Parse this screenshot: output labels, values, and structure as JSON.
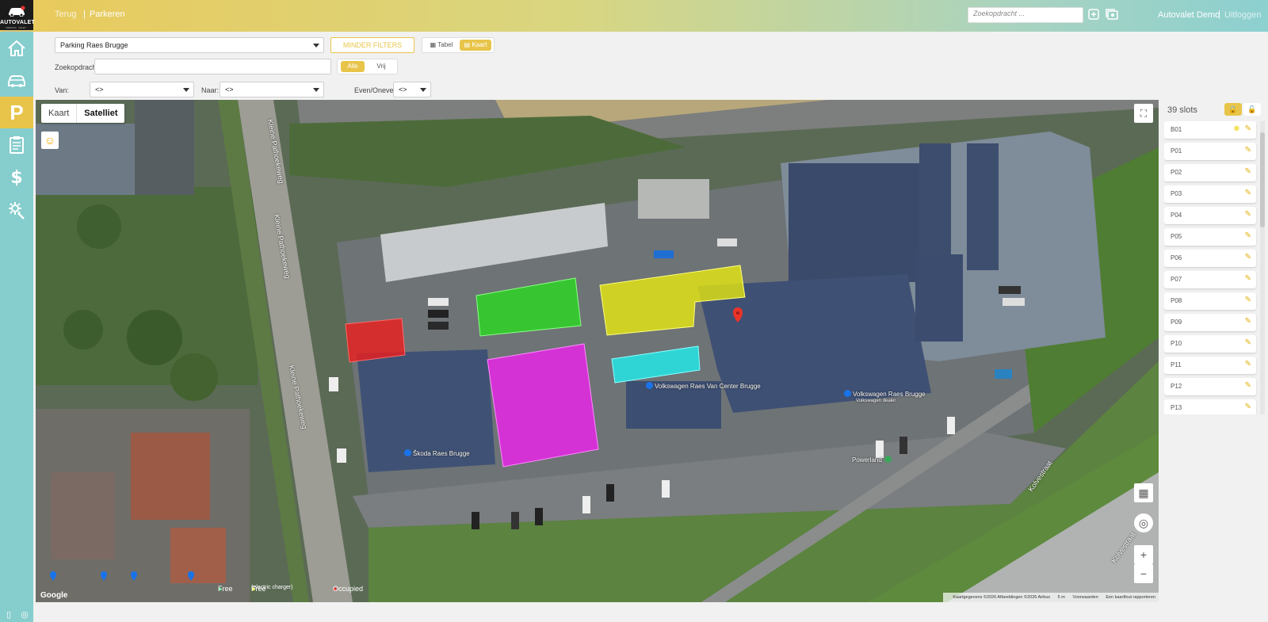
{
  "app": {
    "brand": "AUTOVALET",
    "brand_sub": "PARKING · VALET · TRANSPORT · SERVICE"
  },
  "header": {
    "back_label": "Terug",
    "separator": "|",
    "current_page": "Parkeren",
    "search_placeholder": "Zoekopdracht ...",
    "user_name": "Autovalet Demo",
    "logout_label": "Uitloggen"
  },
  "nav": {
    "items": [
      {
        "icon": "home-icon"
      },
      {
        "icon": "car-icon"
      },
      {
        "icon": "parking-icon",
        "label": "P"
      },
      {
        "icon": "clipboard-icon"
      },
      {
        "icon": "dollar-icon"
      },
      {
        "icon": "settings-icon"
      }
    ]
  },
  "filters": {
    "location_value": "Parking Raes Brugge",
    "less_filters_label": "MINDER FILTERS",
    "view_table_label": "Tabel",
    "view_map_label": "Kaart",
    "search_label": "Zoekopdracht:",
    "search_value": "",
    "status_all_label": "Alle",
    "status_free_label": "Vrij",
    "from_label": "Van:",
    "from_value": "<>",
    "to_label": "Naar:",
    "to_value": "<>",
    "parity_label": "Even/Oneven:",
    "parity_value": "<>"
  },
  "map": {
    "type_map_label": "Kaart",
    "type_satellite_label": "Satelliet",
    "legend_free": "Free",
    "legend_electric": "Free",
    "legend_electric_sub": "(electric charger)",
    "legend_occupied": "Occupied",
    "google_label": "Google",
    "attribution": "Kaartgegevens ©2026 Afbeeldingen ©2026 Airbus",
    "scale": "5 m",
    "terms": "Voorwaarden",
    "report": "Een kaartfout rapporteren",
    "streets": [
      "Kleine Pathoekeweg",
      "Kleine Pathoekeweg",
      "Kleine Pathoekeweg",
      "Kolvestraat",
      "Kolvestraat"
    ],
    "pois": [
      "Volkswagen Raes Van Center Brugge",
      "Volkswagen Raes Brugge",
      "Volkswagen dealer",
      "Škoda Raes Brugge",
      "Powerland"
    ],
    "zone_colors": {
      "red": "#ee1d1d",
      "green": "#25e21b",
      "yellow": "#f0f00a",
      "magenta": "#ee22ee",
      "cyan": "#25e6e6"
    }
  },
  "slots": {
    "count_label": "39 slots",
    "items": [
      "B01",
      "P01",
      "P02",
      "P03",
      "P04",
      "P05",
      "P06",
      "P07",
      "P08",
      "P09",
      "P10",
      "P11",
      "P12",
      "P13"
    ]
  }
}
